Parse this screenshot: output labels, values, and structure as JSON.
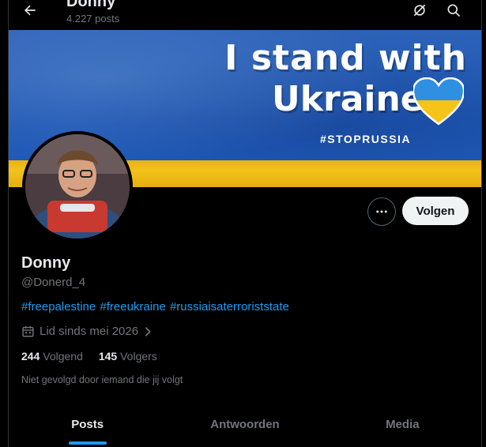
{
  "header": {
    "name": "Donny",
    "post_count": "4.227 posts"
  },
  "banner": {
    "line1": "I stand with",
    "line2": "Ukraine",
    "hashtag": "#STOPRUSSIA",
    "colors": {
      "blue": "#1e57b3",
      "yellow": "#f3c21b"
    }
  },
  "profile": {
    "display_name": "Donny",
    "handle": "@Donerd_4",
    "bio_tags": [
      "#freepalestine",
      "#freeukraine",
      "#russiaisaterroriststate"
    ],
    "joined": "Lid sinds mei 2026",
    "following_count": "244",
    "following_label": "Volgend",
    "followers_count": "145",
    "followers_label": "Volgers",
    "not_followed_text": "Niet gevolgd door iemand die jij volgt"
  },
  "actions": {
    "follow_label": "Volgen",
    "more_icon": "more-horizontal-icon"
  },
  "icons": {
    "back": "arrow-left-icon",
    "grok": "grok-icon",
    "search": "search-icon",
    "calendar": "calendar-icon",
    "chevron": "chevron-right-icon"
  },
  "tabs": [
    {
      "label": "Posts",
      "active": true
    },
    {
      "label": "Antwoorden",
      "active": false
    },
    {
      "label": "Media",
      "active": false
    }
  ],
  "theme": {
    "accent": "#1d9bf0",
    "text": "#e7e9ea",
    "muted": "#71767b",
    "background": "#000000"
  }
}
